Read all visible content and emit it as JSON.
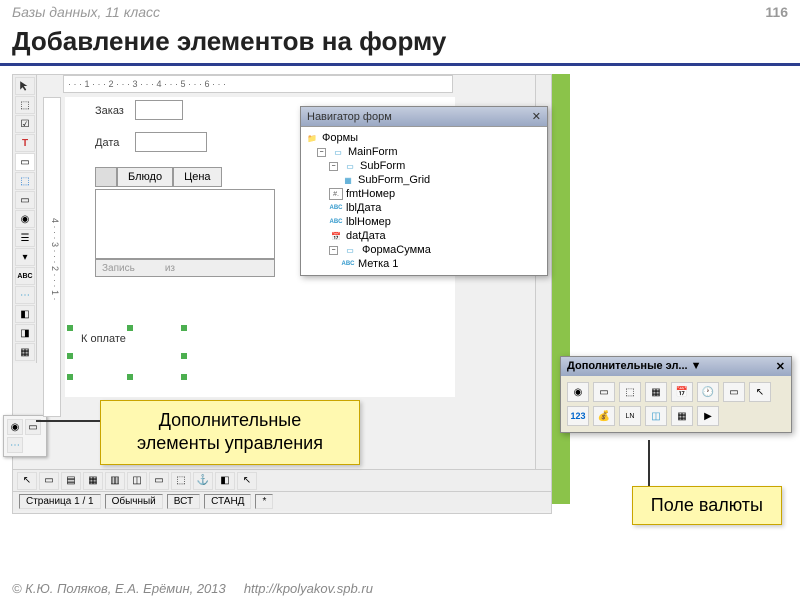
{
  "header": {
    "subject": "Базы данных, 11 класс",
    "page": "116"
  },
  "title": "Добавление элементов на форму",
  "ruler_h": "· · · 1 · · · 2 · · · 3 · · · 4 · · · 5 · · · 6 · · ·",
  "ruler_v": "4 · · · 3 · · · 2 · · · 1 ·",
  "form": {
    "lbl_order": "Заказ",
    "lbl_date": "Дата",
    "col_dish": "Блюдо",
    "col_price": "Цена",
    "rec_label": "Запись",
    "rec_of": "из",
    "pay_label": "К оплате"
  },
  "navigator": {
    "title": "Навигатор форм",
    "root": "Формы",
    "items": [
      {
        "label": "MainForm",
        "type": "form"
      },
      {
        "label": "SubForm",
        "type": "form"
      },
      {
        "label": "SubForm_Grid",
        "type": "grid"
      },
      {
        "label": "fmtНомер",
        "type": "fmt"
      },
      {
        "label": "lblДата",
        "type": "abc"
      },
      {
        "label": "lblНомер",
        "type": "abc"
      },
      {
        "label": "datДата",
        "type": "date"
      },
      {
        "label": "ФормаСумма",
        "type": "form",
        "selected": true
      },
      {
        "label": "Метка 1",
        "type": "abc"
      }
    ]
  },
  "callouts": {
    "extra_controls": "Дополнительные\nэлементы управления",
    "currency_field": "Поле валюты"
  },
  "extra_panel": {
    "title": "Дополнительные эл... ▼"
  },
  "status": {
    "page": "Страница  1 / 1",
    "mode": "Обычный",
    "ins": "ВСТ",
    "std": "СТАНД",
    "star": "*"
  },
  "footer": {
    "copy": "© К.Ю. Поляков, Е.А. Ерёмин, 2013",
    "url": "http://kpolyakov.spb.ru"
  }
}
